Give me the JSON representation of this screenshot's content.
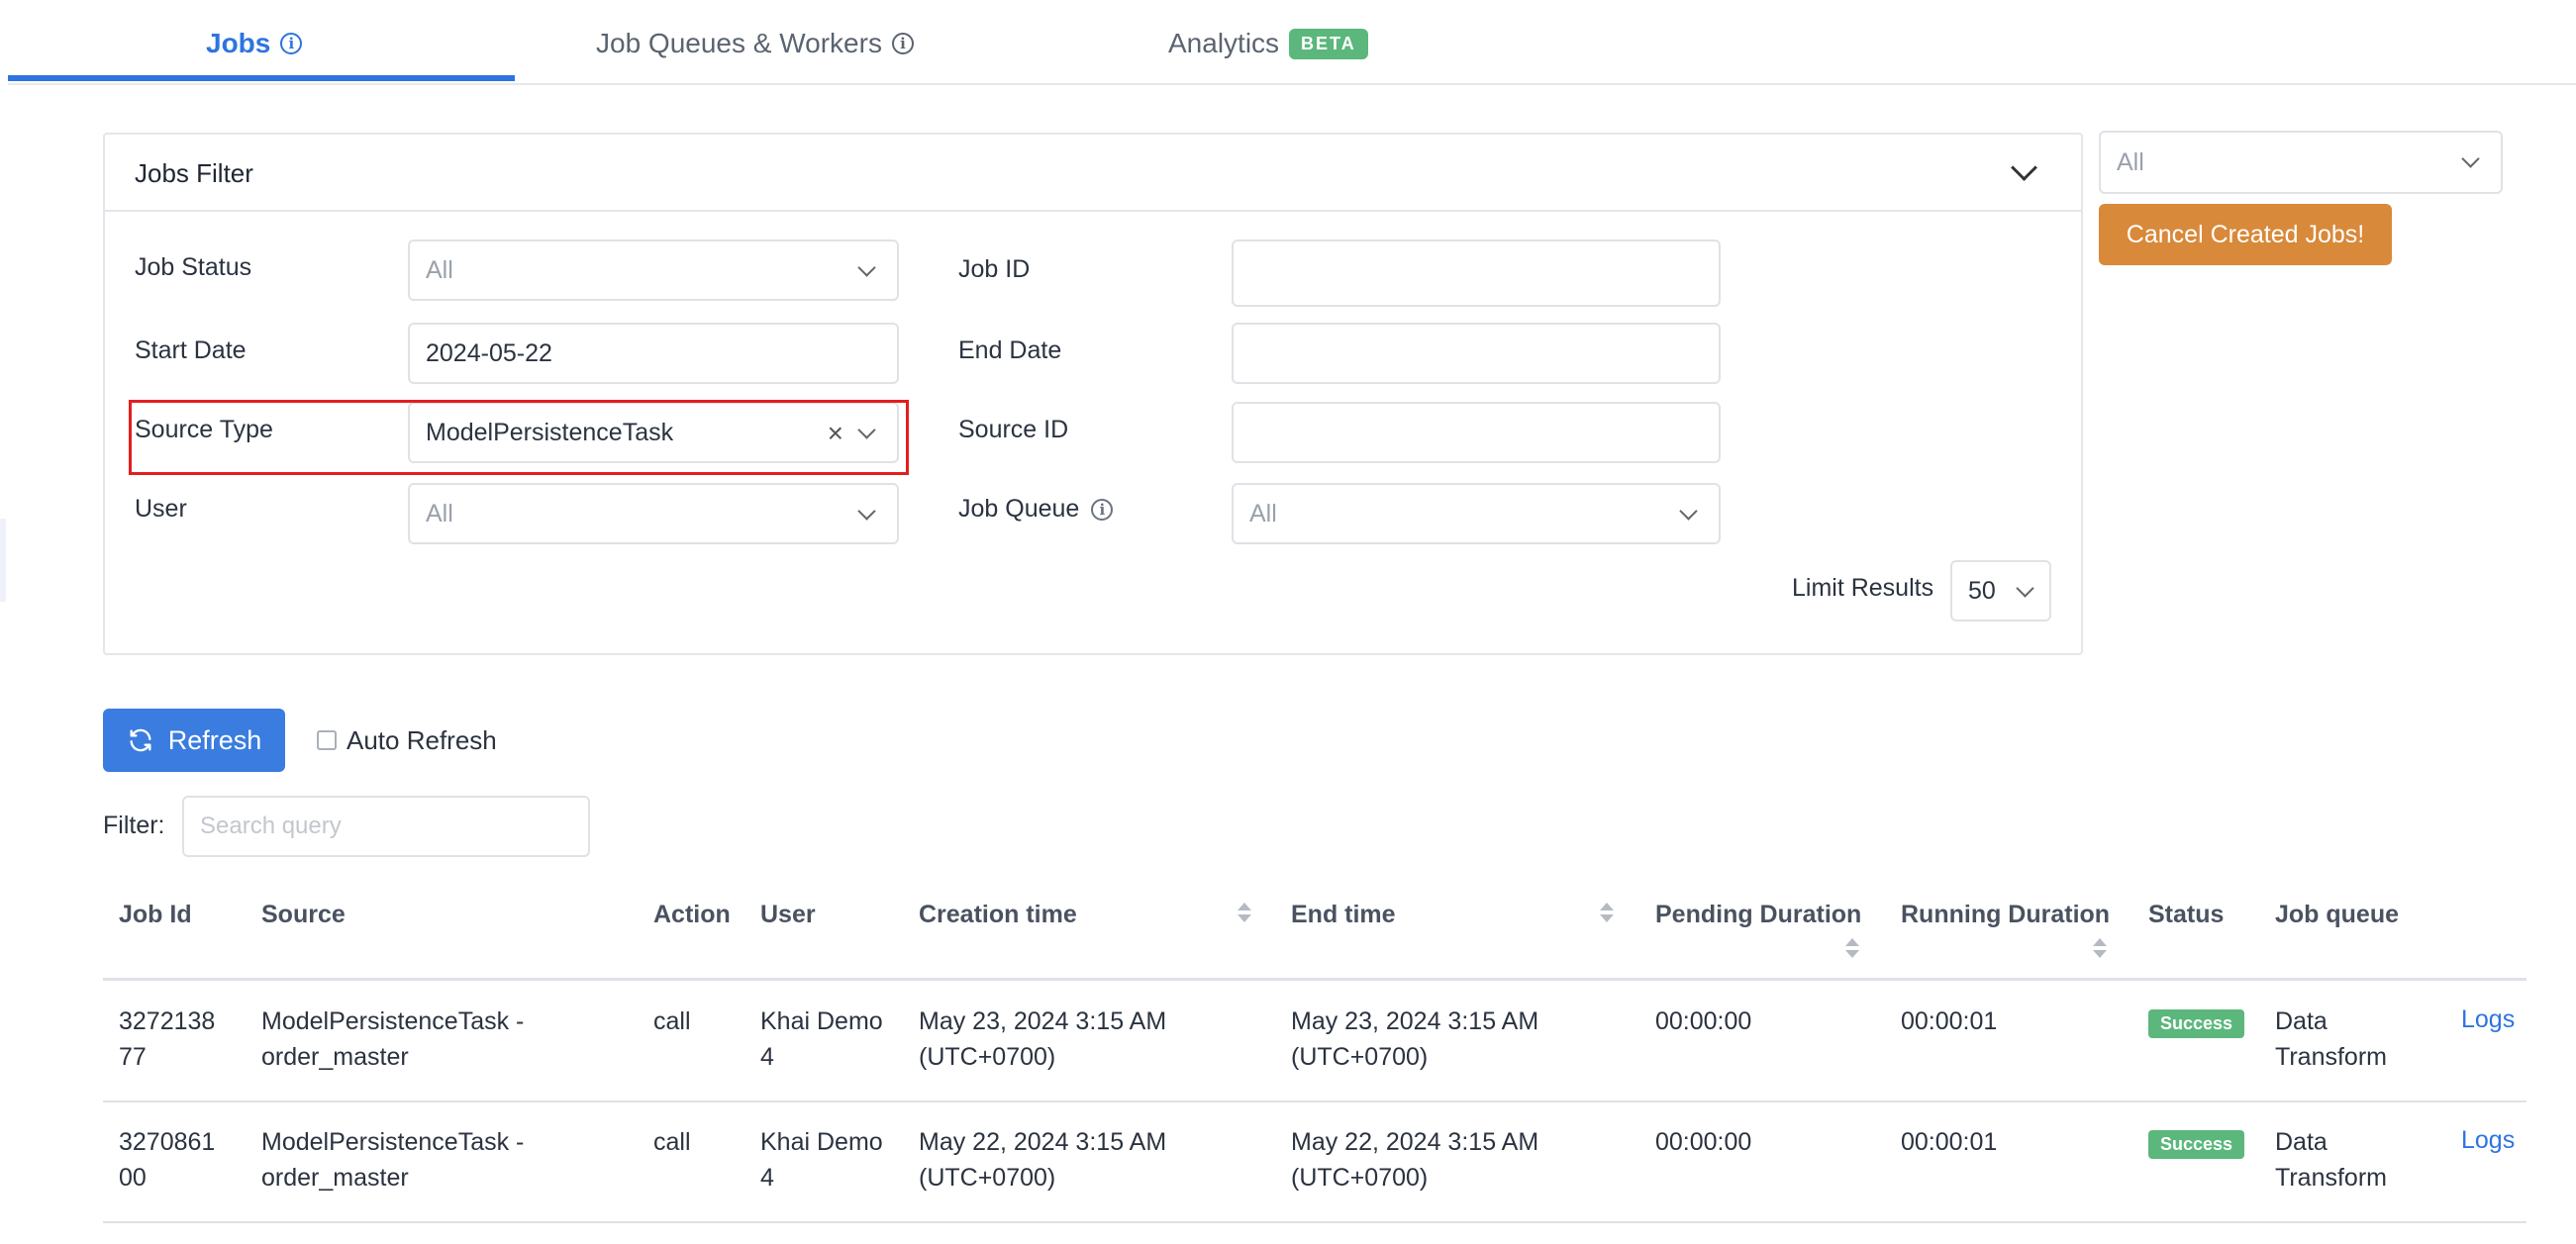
{
  "tabs": [
    {
      "label": "Jobs",
      "active": true
    },
    {
      "label": "Job Queues & Workers",
      "active": false
    },
    {
      "label": "Analytics",
      "badge": "BETA",
      "active": false
    }
  ],
  "filter": {
    "title": "Jobs Filter",
    "job_status": {
      "label": "Job Status",
      "value": "All"
    },
    "job_id": {
      "label": "Job ID",
      "value": ""
    },
    "start_date": {
      "label": "Start Date",
      "value": "2024-05-22"
    },
    "end_date": {
      "label": "End Date",
      "value": ""
    },
    "source_type": {
      "label": "Source Type",
      "value": "ModelPersistenceTask"
    },
    "source_id": {
      "label": "Source ID",
      "value": ""
    },
    "user": {
      "label": "User",
      "value": "All"
    },
    "job_queue": {
      "label": "Job Queue",
      "value": "All"
    },
    "limit": {
      "label": "Limit Results",
      "value": "50"
    }
  },
  "right": {
    "select_value": "All",
    "cancel_label": "Cancel Created Jobs!"
  },
  "controls": {
    "refresh_label": "Refresh",
    "auto_refresh_label": "Auto Refresh",
    "filter_label": "Filter:",
    "search_placeholder": "Search query"
  },
  "table": {
    "headers": [
      "Job Id",
      "Source",
      "Action",
      "User",
      "Creation time",
      "End time",
      "Pending Duration",
      "Running Duration",
      "Status",
      "Job queue"
    ],
    "rows": [
      {
        "job_id": [
          "3272138",
          "77"
        ],
        "source": [
          "ModelPersistenceTask -",
          "order_master"
        ],
        "action": "call",
        "user": [
          "Khai Demo",
          "4"
        ],
        "creation": [
          "May 23, 2024 3:15 AM",
          "(UTC+0700)"
        ],
        "end": [
          "May 23, 2024 3:15 AM",
          "(UTC+0700)"
        ],
        "pending": "00:00:00",
        "running": "00:00:01",
        "status": "Success",
        "queue": [
          "Data",
          "Transform"
        ],
        "logs": "Logs"
      },
      {
        "job_id": [
          "3270861",
          "00"
        ],
        "source": [
          "ModelPersistenceTask -",
          "order_master"
        ],
        "action": "call",
        "user": [
          "Khai Demo",
          "4"
        ],
        "creation": [
          "May 22, 2024 3:15 AM",
          "(UTC+0700)"
        ],
        "end": [
          "May 22, 2024 3:15 AM",
          "(UTC+0700)"
        ],
        "pending": "00:00:00",
        "running": "00:00:01",
        "status": "Success",
        "queue": [
          "Data",
          "Transform"
        ],
        "logs": "Logs"
      }
    ]
  },
  "colors": {
    "accent": "#2e74e0",
    "success": "#5bb77b",
    "warning": "#d8893a",
    "highlight": "#e41d1d"
  }
}
